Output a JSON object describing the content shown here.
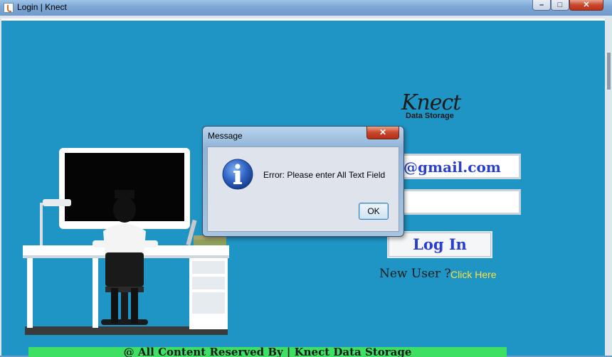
{
  "window": {
    "title": "Login | Knect",
    "min_glyph": "–",
    "max_glyph": "□",
    "close_glyph": "✕"
  },
  "logo": {
    "main": "Knect",
    "sub": "Data Storage"
  },
  "login": {
    "email_value": "@gmail.com",
    "password_value": "",
    "login_label": "Log In",
    "new_user_text": "New User ?",
    "click_here_label": "Click Here"
  },
  "footer": {
    "text": "@ All Content Reserved  By | Knect Data Storage"
  },
  "dialog": {
    "title": "Message",
    "message": "Error: Please enter All Text Field",
    "ok_label": "OK",
    "close_glyph": "✕",
    "icon": "info-icon"
  },
  "colors": {
    "background": "#1e95c4",
    "accent_text": "#2b3fcf",
    "link": "#ffe23a",
    "footer": "#3ee063"
  }
}
